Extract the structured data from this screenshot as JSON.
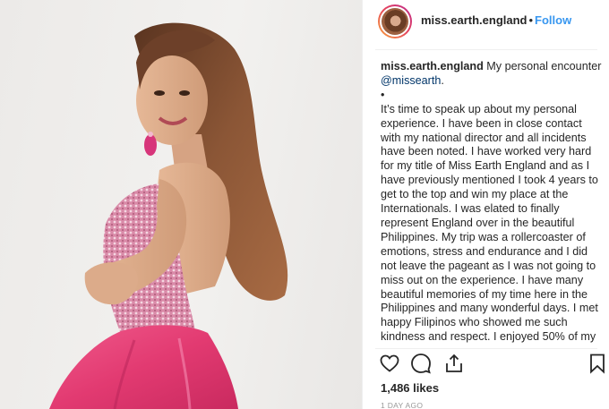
{
  "photo": {
    "alt_subject": "woman-in-pink-gown",
    "dress_color": "#e83f78"
  },
  "header": {
    "username": "miss.earth.england",
    "separator": "•",
    "follow_label": "Follow"
  },
  "caption": {
    "username": "miss.earth.england",
    "intro": "My personal encounter ",
    "mention": "@missearth",
    "intro_end": ".",
    "bullet": "•",
    "body": "It’s time to speak up about my personal experience. I have been in close contact with my national director and all incidents have been noted. I have worked very hard for my title of Miss Earth England and as I have previously mentioned I took 4 years to get to the top and win my place at the Internationals. I was elated to finally represent England over in the beautiful Philippines. My trip was a rollercoaster of emotions, stress and endurance and I did not leave the pageant as I was not going to miss out on the experience. I have many beautiful memories of my time here in the Philippines and many wonderful days. I met happy Filipinos who showed me such kindness and respect. I enjoyed 50% of my"
  },
  "actions": {
    "like_icon": "heart-icon",
    "comment_icon": "comment-icon",
    "share_icon": "share-icon",
    "save_icon": "bookmark-icon"
  },
  "likes": "1,486 likes",
  "time_ago": "1 DAY AGO",
  "colors": {
    "link": "#3897f0",
    "mention": "#003569",
    "muted": "#999999",
    "text": "#262626"
  }
}
